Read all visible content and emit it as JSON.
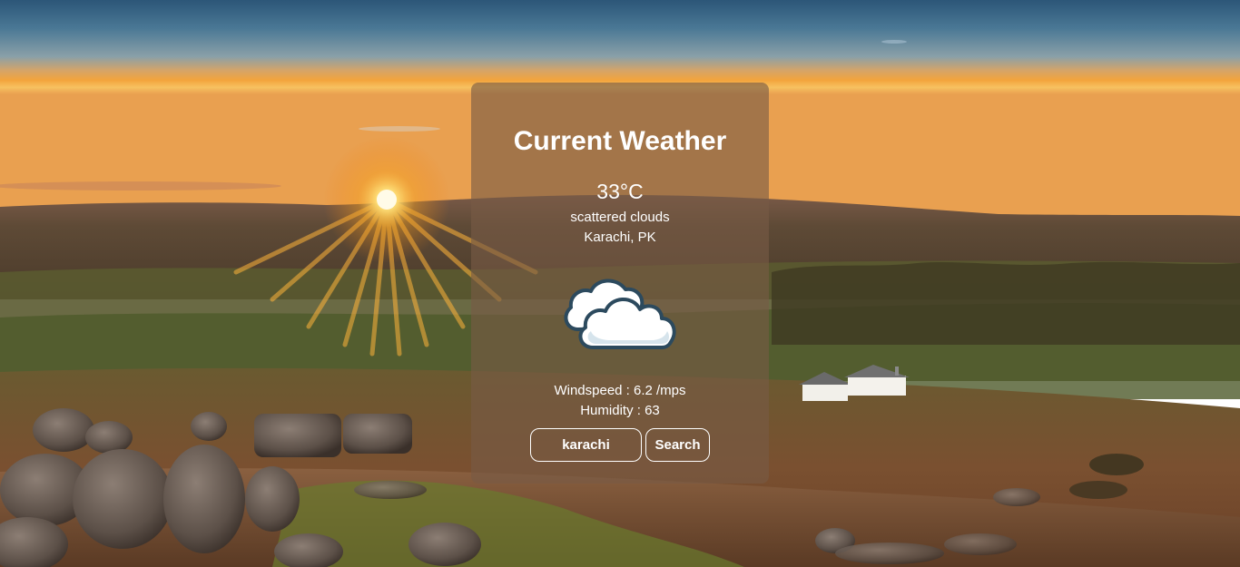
{
  "weather": {
    "title": "Current Weather",
    "temperature": "33°C",
    "description": "scattered clouds",
    "location": "Karachi, PK",
    "windspeed": "Windspeed : 6.2 /mps",
    "humidity": "Humidity : 63",
    "icon": "cloud-icon"
  },
  "search": {
    "value": "karachi",
    "button_label": "Search"
  },
  "background": {
    "description_icon": "landscape-sunset",
    "colors": {
      "sky_top": "#2f5a7c",
      "sky_horizon": "#f0a040",
      "sun": "#fff2b0",
      "ground": "#6e4a2c",
      "card": "#785a46"
    }
  }
}
